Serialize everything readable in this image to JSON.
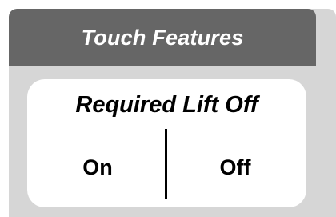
{
  "panel": {
    "title": "Touch Features"
  },
  "setting": {
    "title": "Required Lift Off",
    "options": [
      {
        "label": "On"
      },
      {
        "label": "Off"
      }
    ]
  },
  "colors": {
    "header": "#666666",
    "panel_background": "#d6d6d6",
    "card_background": "#ffffff",
    "title_text": "#ffffff",
    "text": "#000000"
  }
}
